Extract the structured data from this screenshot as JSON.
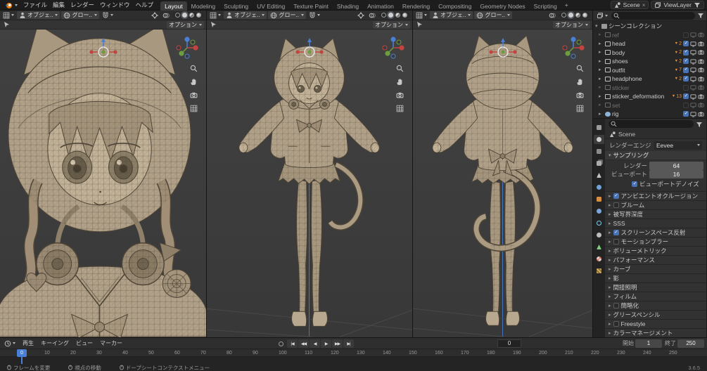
{
  "topbar": {
    "app_menus": [
      "ファイル",
      "編集",
      "レンダー",
      "ウィンドウ",
      "ヘルプ"
    ],
    "workspaces": [
      {
        "label": "Layout",
        "active": true
      },
      {
        "label": "Modeling"
      },
      {
        "label": "Sculpting"
      },
      {
        "label": "UV Editing"
      },
      {
        "label": "Texture Paint"
      },
      {
        "label": "Shading"
      },
      {
        "label": "Animation"
      },
      {
        "label": "Rendering"
      },
      {
        "label": "Compositing"
      },
      {
        "label": "Geometry Nodes"
      },
      {
        "label": "Scripting"
      }
    ],
    "add_workspace": "+",
    "scene_label": "Scene",
    "viewlayer_label": "ViewLayer"
  },
  "viewport": {
    "mode_label": "オブジェ..",
    "orientation_label": "グロー..",
    "options_label": "オプション"
  },
  "outliner": {
    "items": [
      {
        "label": "シーンコレクション",
        "icon": "scenecol",
        "root": true
      },
      {
        "label": "ref",
        "icon": "collection",
        "dim": true,
        "controls": true,
        "checked": false
      },
      {
        "label": "head",
        "icon": "collection",
        "controls": true,
        "checked": true,
        "badge": "2"
      },
      {
        "label": "body",
        "icon": "collection",
        "controls": true,
        "checked": true,
        "badge": "2"
      },
      {
        "label": "shoes",
        "icon": "collection",
        "controls": true,
        "checked": true,
        "badge": "2"
      },
      {
        "label": "outfit",
        "icon": "collection",
        "controls": true,
        "checked": true,
        "badge": "7"
      },
      {
        "label": "headphone",
        "icon": "collection",
        "controls": true,
        "checked": true,
        "badge": "2"
      },
      {
        "label": "sticker",
        "icon": "collection",
        "dim": true,
        "controls": true,
        "checked": false
      },
      {
        "label": "sticker_deformation",
        "icon": "collection",
        "controls": true,
        "checked": true,
        "badge": "13"
      },
      {
        "label": "set",
        "icon": "collection",
        "dim": true,
        "controls": true,
        "checked": false
      },
      {
        "label": "rig",
        "icon": "armature",
        "controls": true,
        "checked": true
      }
    ]
  },
  "properties": {
    "tabs": [
      {
        "name": "tool"
      },
      {
        "name": "render",
        "active": true
      },
      {
        "name": "output"
      },
      {
        "name": "viewlayer"
      },
      {
        "name": "scene"
      },
      {
        "name": "world"
      },
      {
        "name": "object"
      },
      {
        "name": "modifiers"
      },
      {
        "name": "physics"
      },
      {
        "name": "constraints"
      },
      {
        "name": "objectdata"
      },
      {
        "name": "material"
      },
      {
        "name": "texture"
      }
    ],
    "breadcrumb": "Scene",
    "engine_label": "レンダーエンジン",
    "engine_value": "Eevee",
    "sampling_title": "サンプリング",
    "sampling_rows": [
      {
        "label": "レンダー",
        "value": "64"
      },
      {
        "label": "ビューポート",
        "value": "16"
      }
    ],
    "denoise_label": "ビューポートデノイズ",
    "sections": [
      {
        "label": "アンビエントオクルージョン",
        "has_check": true,
        "checked": true
      },
      {
        "label": "ブルーム",
        "has_check": true,
        "checked": false
      },
      {
        "label": "被写界深度"
      },
      {
        "label": "SSS"
      },
      {
        "label": "スクリーンスペース反射",
        "has_check": true,
        "checked": true
      },
      {
        "label": "モーションブラー",
        "has_check": true,
        "checked": false
      },
      {
        "label": "ボリューメトリック"
      },
      {
        "label": "パフォーマンス"
      },
      {
        "label": "カーブ"
      },
      {
        "label": "影"
      },
      {
        "label": "間接照明"
      },
      {
        "label": "フィルム"
      },
      {
        "label": "簡略化",
        "has_check": true,
        "checked": false
      },
      {
        "label": "グリースペンシル"
      },
      {
        "label": "Freestyle",
        "has_check": true,
        "checked": false
      },
      {
        "label": "カラーマネージメント"
      }
    ]
  },
  "timeline": {
    "menus": [
      "再生",
      "キーイング",
      "ビュー",
      "マーカー"
    ],
    "transport": [
      {
        "name": "jump-to-start",
        "glyph": "|◀"
      },
      {
        "name": "previous-keyframe",
        "glyph": "◀◀"
      },
      {
        "name": "play-reverse",
        "glyph": "◀"
      },
      {
        "name": "play",
        "glyph": "▶"
      },
      {
        "name": "next-keyframe",
        "glyph": "▶▶"
      },
      {
        "name": "jump-to-end",
        "glyph": "▶|"
      }
    ],
    "current_frame": "0",
    "playhead_label": "0",
    "start_label": "開始",
    "start_value": "1",
    "end_label": "終了",
    "end_value": "250",
    "ticks": [
      "0",
      "10",
      "20",
      "30",
      "40",
      "50",
      "60",
      "70",
      "80",
      "90",
      "100",
      "110",
      "120",
      "130",
      "140",
      "150",
      "160",
      "170",
      "180",
      "190",
      "200",
      "210",
      "220",
      "230",
      "240",
      "250"
    ]
  },
  "statusbar": {
    "hints": [
      {
        "label": "フレームを変更"
      },
      {
        "label": "視点の移動"
      },
      {
        "label": "ドープシートコンテクストメニュー"
      }
    ],
    "version": "3.6.5"
  },
  "colors": {
    "accent_blue": "#4772b3",
    "playhead_blue": "#4a7fd6",
    "axis_x_red": "#c3443f",
    "axis_y_green": "#6b9e3e",
    "axis_z_blue": "#4a7fd6",
    "badge_orange": "#e8913a",
    "model_clay": "#b1a189"
  }
}
